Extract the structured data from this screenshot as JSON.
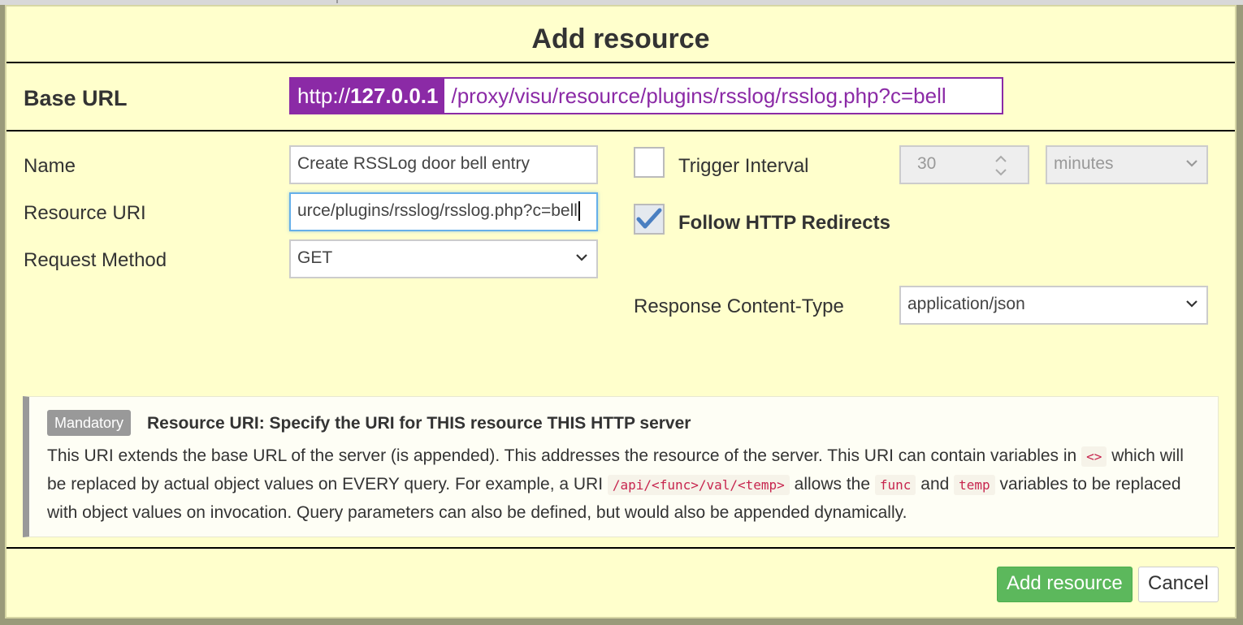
{
  "dialog": {
    "title": "Add resource",
    "base_url": {
      "label": "Base URL",
      "scheme": "http://",
      "host": "127.0.0.1",
      "path": "/proxy/visu/resource/plugins/rsslog/rsslog.php?c=bell"
    },
    "fields": {
      "name_label": "Name",
      "name_value": "Create RSSLog door bell entry",
      "uri_label": "Resource URI",
      "uri_value": "urce/plugins/rsslog/rsslog.php?c=bell",
      "method_label": "Request Method",
      "method_value": "GET"
    },
    "trigger": {
      "label": "Trigger Interval",
      "checked": false,
      "interval_value": "30",
      "unit_value": "minutes"
    },
    "redirects": {
      "label": "Follow HTTP Redirects",
      "checked": true
    },
    "content_type": {
      "label": "Response Content-Type",
      "value": "application/json"
    },
    "hint": {
      "badge": "Mandatory",
      "title": "Resource URI: Specify the URI for THIS resource THIS HTTP server",
      "text_1": "This URI extends the base URL of the server (is appended). This addresses the resource of the server. This URI can contain variables in",
      "code_1": "<>",
      "text_2": "which will be replaced by actual object values on EVERY query. For example, a URI",
      "code_2": "/api/<func>/val/<temp>",
      "text_3": "allows the",
      "code_3": "func",
      "text_4": "and",
      "code_4": "temp",
      "text_5": "variables to be replaced with object values on invocation. Query parameters can also be defined, but would also be appended dynamically."
    },
    "buttons": {
      "add": "Add resource",
      "cancel": "Cancel"
    },
    "colors": {
      "dialog_bg": "#ffffcc",
      "accent_purple": "#8b2aa6",
      "primary_green": "#5cb85c",
      "code_red": "#c7254e"
    }
  }
}
